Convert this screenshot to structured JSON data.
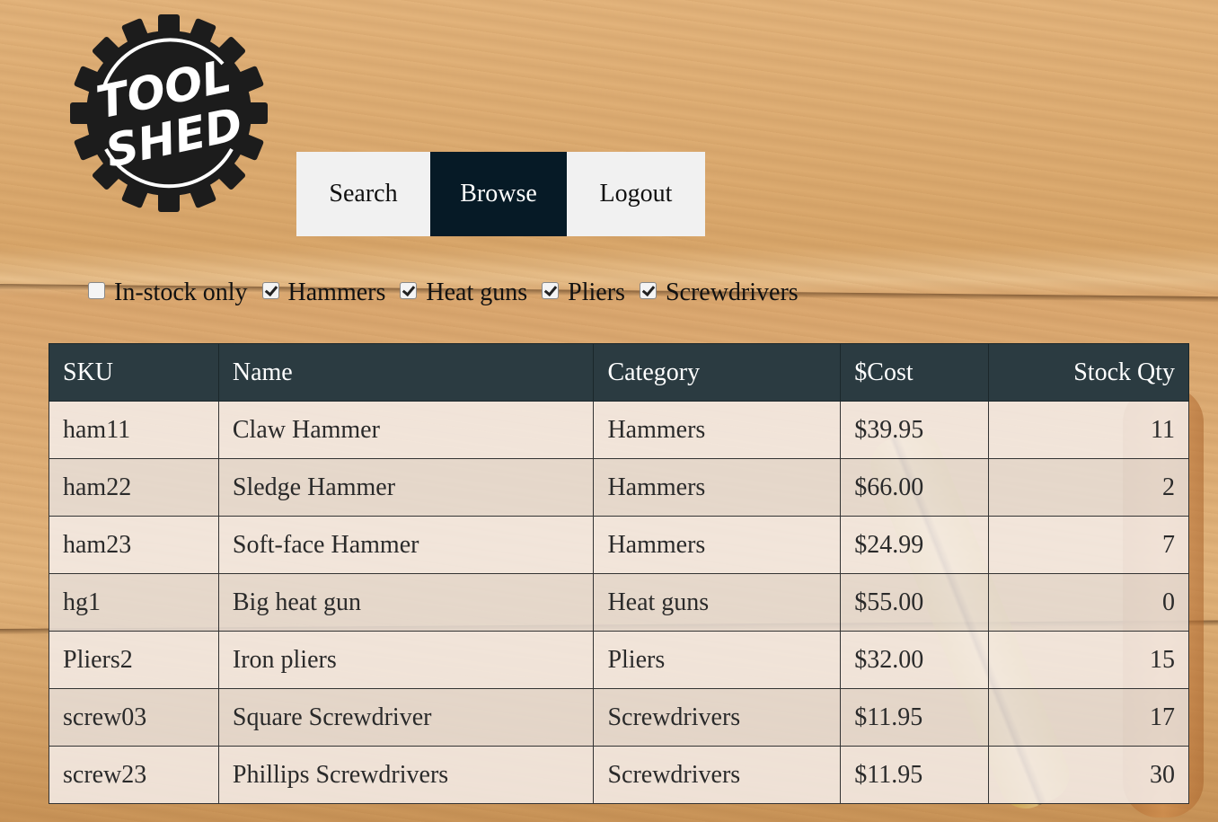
{
  "brand": {
    "logo_text_line1": "TOOL",
    "logo_text_line2": "SHED"
  },
  "nav": {
    "items": [
      {
        "label": "Search",
        "active": false
      },
      {
        "label": "Browse",
        "active": true
      },
      {
        "label": "Logout",
        "active": false
      }
    ]
  },
  "filters": [
    {
      "label": "In-stock only",
      "checked": false
    },
    {
      "label": "Hammers",
      "checked": true
    },
    {
      "label": "Heat guns",
      "checked": true
    },
    {
      "label": "Pliers",
      "checked": true
    },
    {
      "label": "Screwdrivers",
      "checked": true
    }
  ],
  "table": {
    "headers": [
      "SKU",
      "Name",
      "Category",
      "$Cost",
      "Stock Qty"
    ],
    "rows": [
      [
        "ham11",
        "Claw Hammer",
        "Hammers",
        "$39.95",
        "11"
      ],
      [
        "ham22",
        "Sledge Hammer",
        "Hammers",
        "$66.00",
        "2"
      ],
      [
        "ham23",
        "Soft-face Hammer",
        "Hammers",
        "$24.99",
        "7"
      ],
      [
        "hg1",
        "Big heat gun",
        "Heat guns",
        "$55.00",
        "0"
      ],
      [
        "Pliers2",
        "Iron pliers",
        "Pliers",
        "$32.00",
        "15"
      ],
      [
        "screw03",
        "Square Screwdriver",
        "Screwdrivers",
        "$11.95",
        "17"
      ],
      [
        "screw23",
        "Phillips Screwdrivers",
        "Screwdrivers",
        "$11.95",
        "30"
      ]
    ]
  },
  "colors": {
    "nav_active_bg": "#061a26",
    "table_header_bg": "#2b3b41"
  }
}
